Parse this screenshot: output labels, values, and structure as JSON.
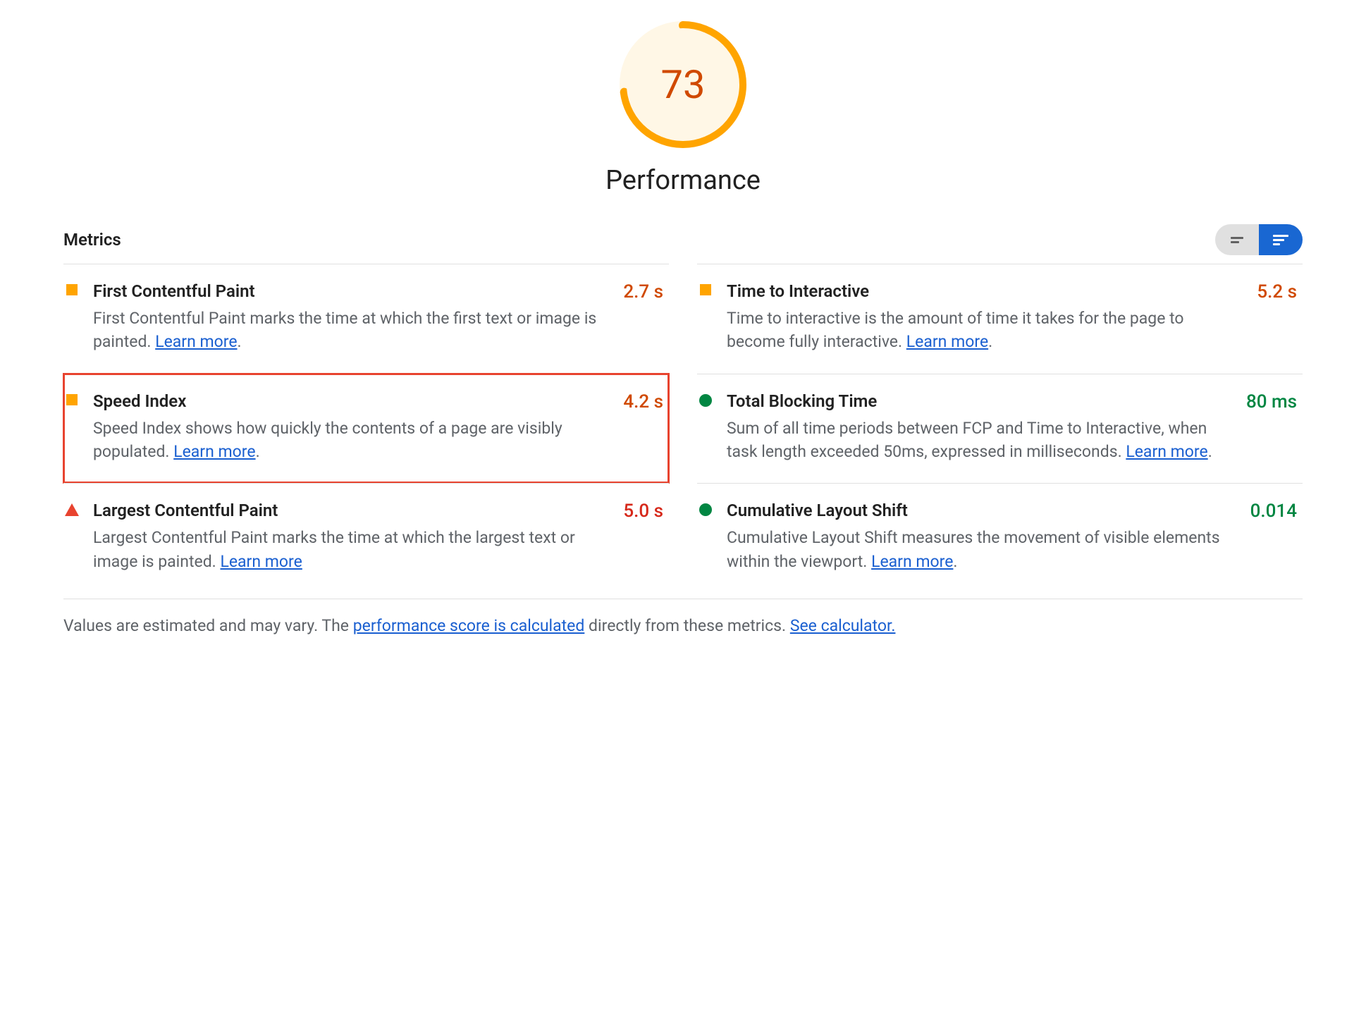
{
  "header": {
    "score": "73",
    "title": "Performance"
  },
  "metrics_label": "Metrics",
  "learn_more": "Learn more",
  "metrics": {
    "fcp": {
      "title": "First Contentful Paint",
      "desc": "First Contentful Paint marks the time at which the first text or image is painted. ",
      "value": "2.7 s"
    },
    "tti": {
      "title": "Time to Interactive",
      "desc": "Time to interactive is the amount of time it takes for the page to become fully interactive. ",
      "value": "5.2 s"
    },
    "si": {
      "title": "Speed Index",
      "desc": "Speed Index shows how quickly the contents of a page are visibly populated. ",
      "value": "4.2 s"
    },
    "tbt": {
      "title": "Total Blocking Time",
      "desc": "Sum of all time periods between FCP and Time to Interactive, when task length exceeded 50ms, expressed in milliseconds. ",
      "value": "80 ms"
    },
    "lcp": {
      "title": "Largest Contentful Paint",
      "desc": "Largest Contentful Paint marks the time at which the largest text or image is painted. ",
      "value": "5.0 s"
    },
    "cls": {
      "title": "Cumulative Layout Shift",
      "desc": "Cumulative Layout Shift measures the movement of visible elements within the viewport. ",
      "value": "0.014"
    }
  },
  "footer": {
    "pre": "Values are estimated and may vary. The ",
    "link1": "performance score is calculated",
    "mid": " directly from these metrics. ",
    "link2": "See calculator."
  }
}
